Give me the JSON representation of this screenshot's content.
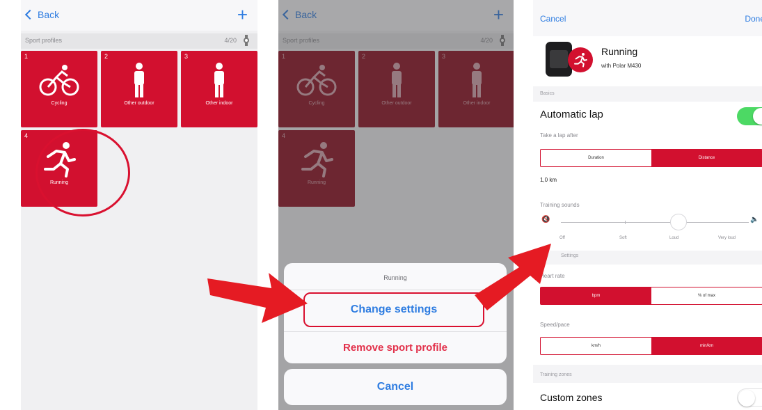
{
  "colors": {
    "accent_red": "#d2102f",
    "ios_blue": "#2f7de1",
    "toggle_green": "#4cd964",
    "annotation_red": "#e51b23"
  },
  "panel1": {
    "nav": {
      "back_label": "Back",
      "add_icon": "plus-icon"
    },
    "section_title": "Sport profiles",
    "section_count": "4/20",
    "tiles": [
      {
        "num": "1",
        "label": "Cycling",
        "icon": "cycling-icon"
      },
      {
        "num": "2",
        "label": "Other outdoor",
        "icon": "person-icon"
      },
      {
        "num": "3",
        "label": "Other indoor",
        "icon": "person-icon"
      },
      {
        "num": "4",
        "label": "Running",
        "icon": "running-icon"
      }
    ]
  },
  "panel2": {
    "nav": {
      "back_label": "Back"
    },
    "section_title": "Sport profiles",
    "section_count": "4/20",
    "action_sheet": {
      "title": "Running",
      "change": "Change settings",
      "remove": "Remove sport profile",
      "cancel": "Cancel"
    }
  },
  "panel3": {
    "cancel": "Cancel",
    "done": "Done",
    "title": "Running",
    "subtitle": "with Polar M430",
    "section_basics": "Basics",
    "automatic_lap": "Automatic lap",
    "automatic_lap_on": true,
    "take_lap_after": "Take a lap after",
    "lap_options": [
      "Duration",
      "Distance"
    ],
    "lap_selected_index": 1,
    "lap_value": "1,0 km",
    "training_sounds": "Training sounds",
    "sound_levels": [
      "Off",
      "Soft",
      "Loud",
      "Very loud"
    ],
    "sound_selected_index": 2,
    "section_settings": "Settings",
    "heart_rate": "Heart rate",
    "hr_options": [
      "bpm",
      "% of max"
    ],
    "hr_selected_index": 0,
    "speed_pace": "Speed/pace",
    "speed_options": [
      "km/h",
      "min/km"
    ],
    "speed_selected_index": 1,
    "section_zones": "Training zones",
    "custom_zones": "Custom zones",
    "custom_zones_on": false
  }
}
